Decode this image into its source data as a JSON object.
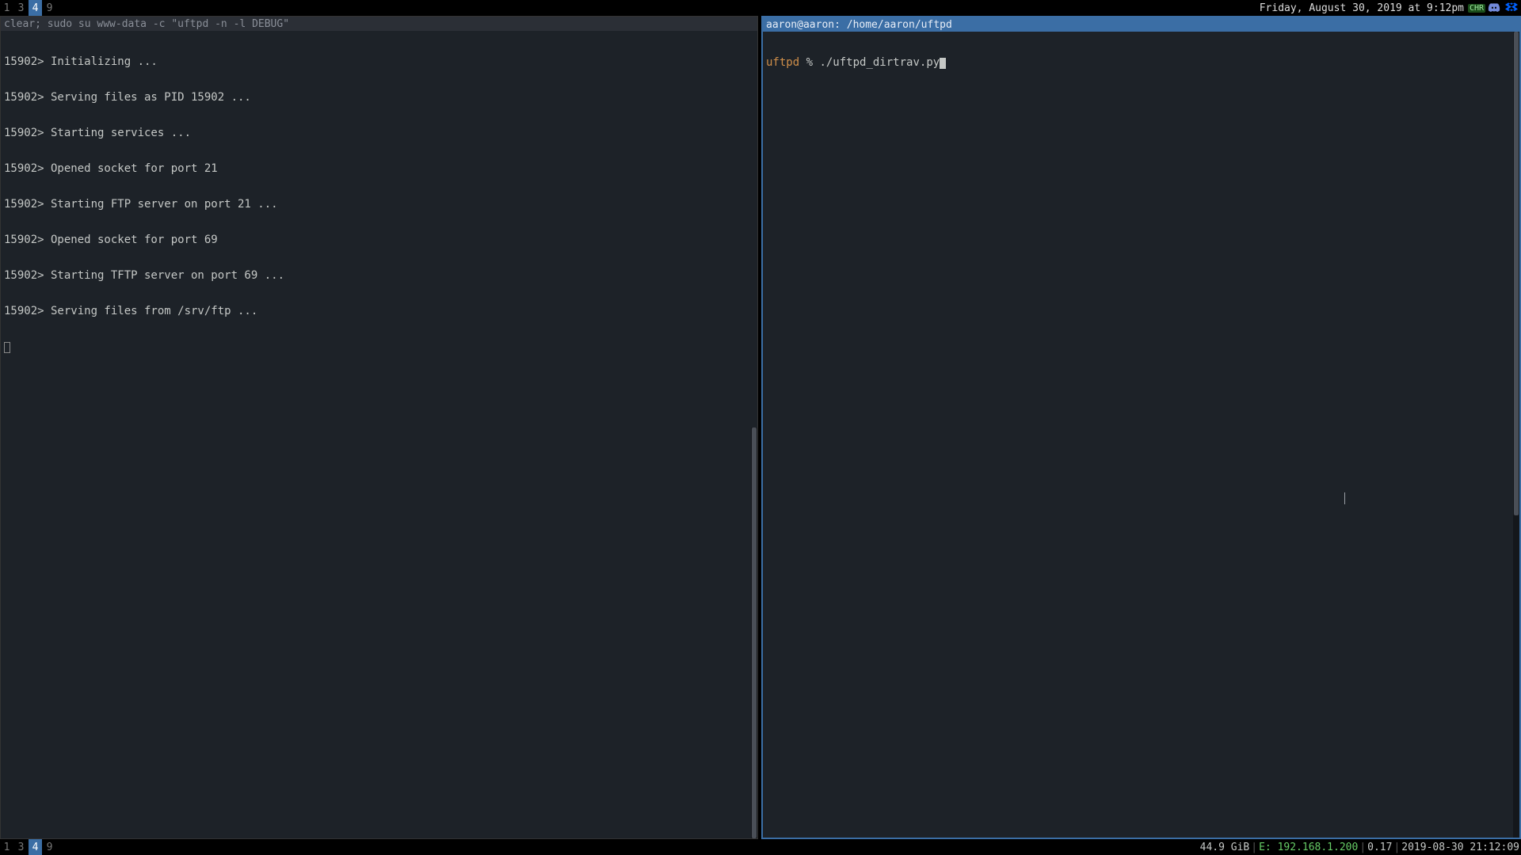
{
  "topbar": {
    "workspaces": [
      "1",
      "3",
      "4",
      "9"
    ],
    "active_ws": "4",
    "clock": "Friday, August 30, 2019 at 9:12pm",
    "tray_kbd": "CHR"
  },
  "left_pane": {
    "title": "clear; sudo su www-data -c \"uftpd -n -l DEBUG\"",
    "lines": [
      "15902> Initializing ...",
      "15902> Serving files as PID 15902 ...",
      "15902> Starting services ...",
      "15902> Opened socket for port 21",
      "15902> Starting FTP server on port 21 ...",
      "15902> Opened socket for port 69",
      "15902> Starting TFTP server on port 69 ...",
      "15902> Serving files from /srv/ftp ..."
    ]
  },
  "right_pane": {
    "title": "aaron@aaron: /home/aaron/uftpd",
    "prompt_dir": "uftpd",
    "prompt_sep": " % ",
    "prompt_cmd": "./uftpd_dirtrav.py"
  },
  "bottombar": {
    "workspaces": [
      "1",
      "3",
      "4",
      "9"
    ],
    "active_ws": "4",
    "mem": "44.9 GiB",
    "eth_label": "E: ",
    "eth_ip": "192.168.1.200",
    "load": "0.17",
    "datetime": "2019-08-30 21:12:09"
  }
}
